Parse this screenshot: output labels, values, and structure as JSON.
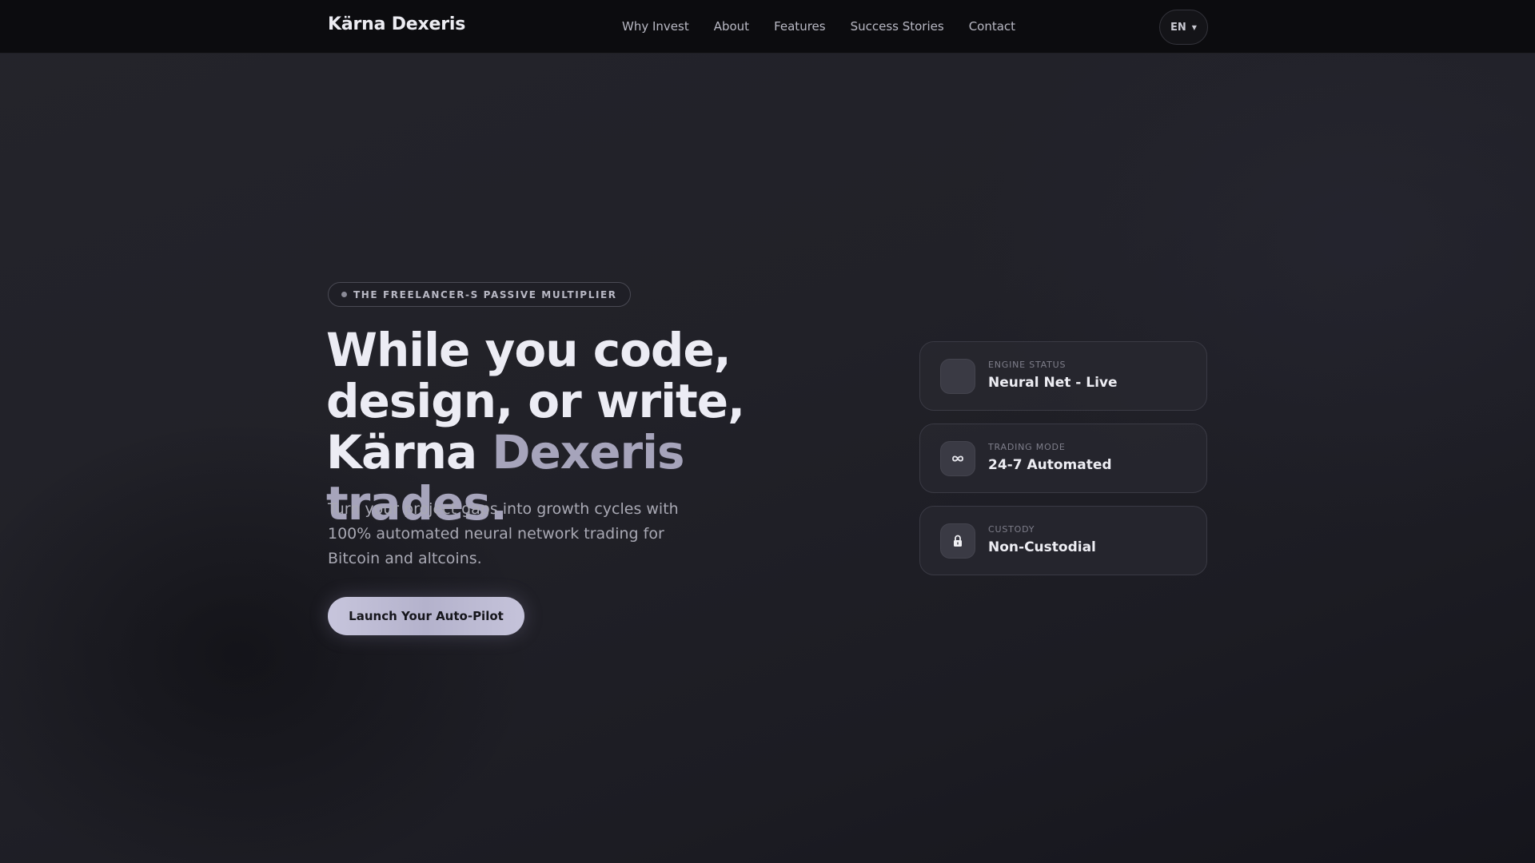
{
  "brand": {
    "name": "Kärna Dexeris"
  },
  "nav": {
    "links": [
      {
        "label": "Why Invest"
      },
      {
        "label": "About"
      },
      {
        "label": "Features"
      },
      {
        "label": "Success Stories"
      },
      {
        "label": "Contact"
      }
    ],
    "language": "EN"
  },
  "hero": {
    "badge": "THE FREELANCER-S PASSIVE MULTIPLIER",
    "headline_line1": "While you code,",
    "headline_line2": "design, or write,",
    "headline_brand": "Kärna",
    "headline_accent": "Dexeris trades.",
    "subtext": "Turn your project gaps into growth cycles with 100% automated neural network trading for Bitcoin and altcoins.",
    "cta_label": "Launch Your Auto-Pilot"
  },
  "status_cards": [
    {
      "label": "ENGINE STATUS",
      "value": "Neural Net - Live",
      "icon": "blank-icon"
    },
    {
      "label": "TRADING MODE",
      "value": "24-7 Automated",
      "icon": "infinity-icon"
    },
    {
      "label": "CUSTODY",
      "value": "Non-Custodial",
      "icon": "lock-icon"
    }
  ],
  "colors": {
    "navbar": "#0c0c0f",
    "accent": "#a6a4bb",
    "cta": "#c0bed6"
  }
}
